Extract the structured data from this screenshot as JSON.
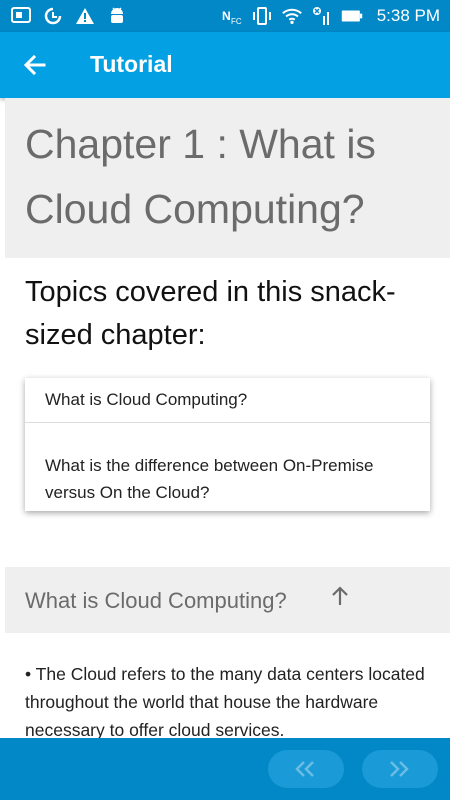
{
  "status_bar": {
    "time": "5:38 PM",
    "left_icons": [
      "screen-mirror-icon",
      "sync-icon",
      "warning-icon",
      "android-debug-icon"
    ],
    "right_icons": [
      "nfc-icon",
      "vibrate-icon",
      "wifi-icon",
      "no-signal-icon",
      "battery-icon"
    ]
  },
  "app_bar": {
    "title": "Tutorial",
    "back_icon": "arrow-left-icon"
  },
  "chapter": {
    "title": "Chapter 1 : What is Cloud Computing?"
  },
  "topics": {
    "heading": "Topics covered in this snack-sized chapter:",
    "items": [
      "What is Cloud Computing?",
      "What is the difference between On-Premise versus On the Cloud?"
    ]
  },
  "section": {
    "title": "What is Cloud Computing?",
    "up_icon": "arrow-up-icon",
    "body": "• The Cloud refers to the many data centers located throughout the world that house the hardware necessary to offer cloud services."
  },
  "bottom_bar": {
    "prev_icon": "chevron-left-icon",
    "next_icon": "chevron-right-icon"
  },
  "colors": {
    "status_bar": "#0288c7",
    "app_bar": "#03a0e3",
    "header_bg": "#efefef",
    "header_text": "#6b6b6b"
  }
}
